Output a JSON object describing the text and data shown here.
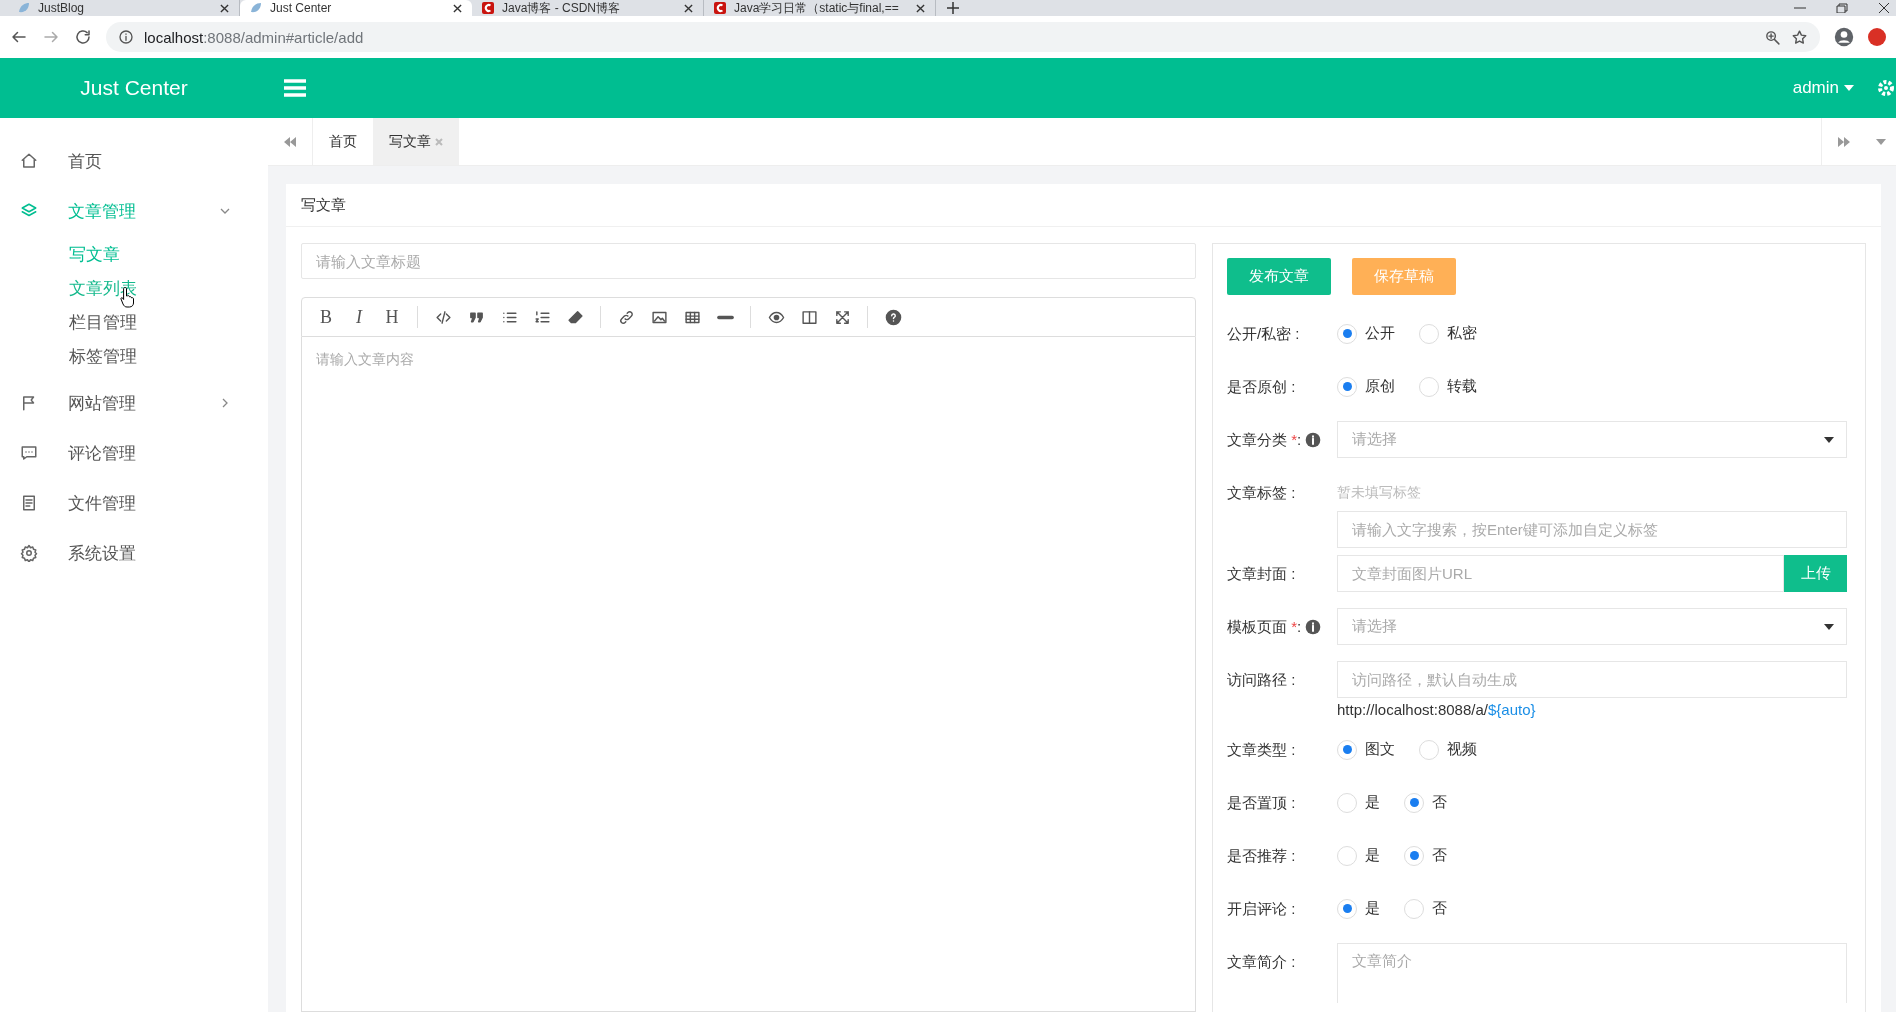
{
  "browser": {
    "tabs": [
      {
        "title": "JustBlog",
        "kind": "leaf",
        "selected": false
      },
      {
        "title": "Just Center",
        "kind": "leaf",
        "selected": true
      },
      {
        "title": "Java博客 - CSDN博客",
        "kind": "csdn",
        "selected": false
      },
      {
        "title": "Java学习日常（static与final,==",
        "kind": "csdn",
        "selected": false
      }
    ],
    "url_host": "localhost",
    "url_path": ":8088/admin#article/add"
  },
  "header": {
    "brand": "Just Center",
    "user": "admin"
  },
  "sidebar": {
    "items": [
      {
        "label": "首页",
        "kind": "home",
        "selected": false
      },
      {
        "label": "文章管理",
        "kind": "layers",
        "selected": true,
        "expanded": true,
        "children": [
          {
            "label": "写文章",
            "selected": true,
            "hovered": false
          },
          {
            "label": "文章列表",
            "selected": false,
            "hovered": true
          },
          {
            "label": "栏目管理",
            "selected": false,
            "hovered": false
          },
          {
            "label": "标签管理",
            "selected": false,
            "hovered": false
          }
        ]
      },
      {
        "label": "网站管理",
        "kind": "flag",
        "selected": false,
        "expanded": false
      },
      {
        "label": "评论管理",
        "kind": "comment",
        "selected": false
      },
      {
        "label": "文件管理",
        "kind": "file",
        "selected": false
      },
      {
        "label": "系统设置",
        "kind": "gear",
        "selected": false
      }
    ]
  },
  "page_tabs": [
    {
      "label": "首页",
      "selected": false,
      "closable": false
    },
    {
      "label": "写文章",
      "selected": true,
      "closable": true
    }
  ],
  "card": {
    "title": "写文章"
  },
  "editor": {
    "title_placeholder": "请输入文章标题",
    "content_placeholder": "请输入文章内容",
    "toolbar": [
      {
        "kind": "bold",
        "label": "B"
      },
      {
        "kind": "italic",
        "label": "I"
      },
      {
        "kind": "heading",
        "label": "H"
      },
      {
        "kind": "separator"
      },
      {
        "kind": "code"
      },
      {
        "kind": "quote"
      },
      {
        "kind": "bullets"
      },
      {
        "kind": "numbers"
      },
      {
        "kind": "eraser"
      },
      {
        "kind": "separator"
      },
      {
        "kind": "link"
      },
      {
        "kind": "image"
      },
      {
        "kind": "table"
      },
      {
        "kind": "rule"
      },
      {
        "kind": "separator"
      },
      {
        "kind": "eye"
      },
      {
        "kind": "columns"
      },
      {
        "kind": "fullscreen"
      },
      {
        "kind": "separator"
      },
      {
        "kind": "help"
      }
    ]
  },
  "form": {
    "buttons": [
      {
        "label": "发布文章",
        "kind": "primary"
      },
      {
        "label": "保存草稿",
        "kind": "warning"
      }
    ],
    "fields": [
      {
        "kind": "radio",
        "label": "公开/私密 :",
        "options": [
          {
            "label": "公开",
            "selected": true
          },
          {
            "label": "私密",
            "selected": false
          }
        ]
      },
      {
        "kind": "radio",
        "label": "是否原创 :",
        "options": [
          {
            "label": "原创",
            "selected": true
          },
          {
            "label": "转载",
            "selected": false
          }
        ]
      },
      {
        "kind": "select",
        "label": "文章分类",
        "required_mark": "*",
        "colon": ":",
        "placeholder": "请选择"
      },
      {
        "kind": "tags",
        "label": "文章标签 :",
        "note": "暂未填写标签",
        "placeholder": "请输入文字搜索，按Enter键可添加自定义标签"
      },
      {
        "kind": "upload",
        "label": "文章封面 :",
        "placeholder": "文章封面图片URL",
        "button": "上传"
      },
      {
        "kind": "select",
        "label": "模板页面",
        "required_mark": "*",
        "colon": ":",
        "placeholder": "请选择"
      },
      {
        "kind": "path",
        "label": "访问路径 :",
        "placeholder": "访问路径，默认自动生成",
        "hint_prefix": "http://localhost:8088/a/",
        "hint_link": "${auto}"
      },
      {
        "kind": "radio",
        "label": "文章类型 :",
        "options": [
          {
            "label": "图文",
            "selected": true
          },
          {
            "label": "视频",
            "selected": false
          }
        ]
      },
      {
        "kind": "radio",
        "label": "是否置顶 :",
        "options": [
          {
            "label": "是",
            "selected": false
          },
          {
            "label": "否",
            "selected": true
          }
        ]
      },
      {
        "kind": "radio",
        "label": "是否推荐 :",
        "options": [
          {
            "label": "是",
            "selected": false
          },
          {
            "label": "否",
            "selected": true
          }
        ]
      },
      {
        "kind": "radio",
        "label": "开启评论 :",
        "options": [
          {
            "label": "是",
            "selected": true
          },
          {
            "label": "否",
            "selected": false
          }
        ]
      },
      {
        "kind": "textarea",
        "label": "文章简介 :",
        "placeholder": "文章简介"
      }
    ]
  }
}
